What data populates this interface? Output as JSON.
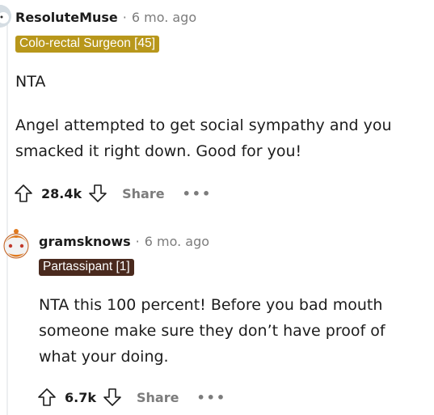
{
  "comments": [
    {
      "username": "ResoluteMuse",
      "separator": "·",
      "time": "6 mo. ago",
      "flair": "Colo-rectal Surgeon [45]",
      "flair_color": "#b8971b",
      "paragraphs": [
        "NTA",
        "Angel attempted to get social sympathy and you smacked it right down. Good for you!"
      ],
      "score": "28.4k",
      "share_label": "Share",
      "more_label": "•••",
      "upvote_icon": "upvote-arrow-icon",
      "downvote_icon": "downvote-arrow-icon"
    },
    {
      "username": "gramsknows",
      "separator": "·",
      "time": "6 mo. ago",
      "flair": "Partassipant [1]",
      "flair_color": "#4a2a1e",
      "paragraphs": [
        "NTA this 100 percent! Before you bad mouth someone make sure they don’t have proof of what your doing."
      ],
      "score": "6.7k",
      "share_label": "Share",
      "more_label": "•••",
      "upvote_icon": "upvote-arrow-icon",
      "downvote_icon": "downvote-arrow-icon"
    }
  ]
}
